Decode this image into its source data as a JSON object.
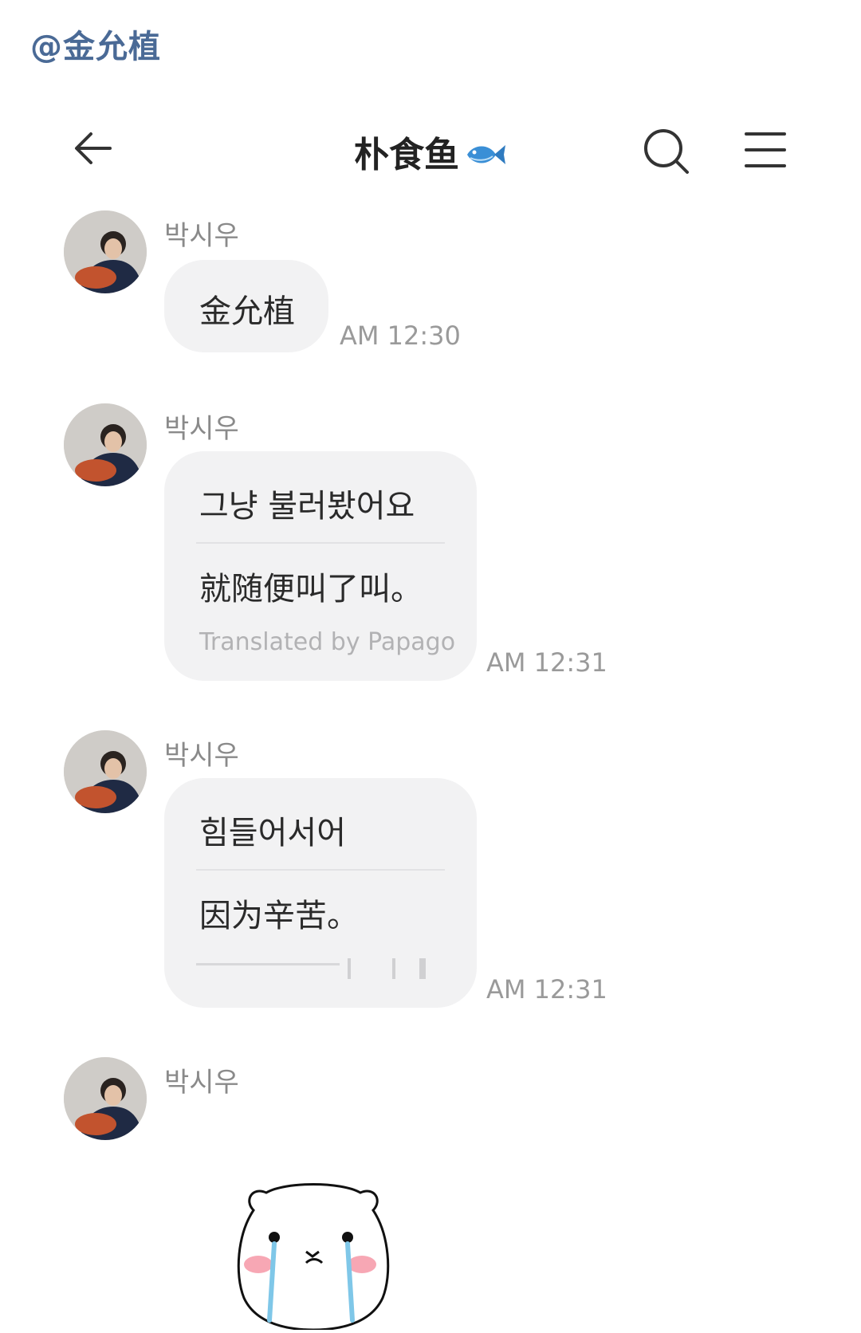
{
  "watermark": "@金允植",
  "header": {
    "title": "朴食鱼",
    "title_emoji": "fish-icon"
  },
  "messages": [
    {
      "sender": "박시우",
      "text": "金允植",
      "time": "AM 12:30"
    },
    {
      "sender": "박시우",
      "text": "그냥 불러봤어요",
      "translation": "就随便叫了叫。",
      "note": "Translated by Papago",
      "time": "AM 12:31"
    },
    {
      "sender": "박시우",
      "text": "힘들어서어",
      "translation": "因为辛苦。",
      "time": "AM 12:31"
    },
    {
      "sender": "박시우",
      "sticker": "crying-bear-sticker"
    }
  ],
  "colors": {
    "bubble": "#f2f2f3",
    "watermark": "#4a6a96",
    "fish": "#3a8fd6"
  }
}
